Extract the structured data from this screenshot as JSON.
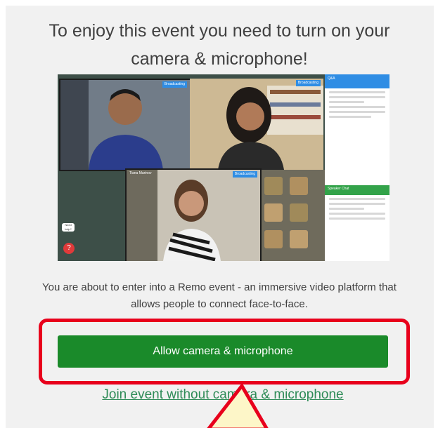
{
  "headline": "To enjoy this event you need to turn on your camera & microphone!",
  "preview": {
    "tag_1": "Broadcasting",
    "tag_2": "Broadcasting",
    "tag_3": "Broadcasting",
    "tile_3_name": "Tiana Marinov",
    "chat_title": "Q&A",
    "chat_section": "Speaker Chat",
    "help_label": "Need help?"
  },
  "description": "You are about to enter into a Remo event - an immersive video platform that allows people to connect face-to-face.",
  "allow_button": "Allow camera & microphone",
  "join_link": "Join event without camera & microphone",
  "colors": {
    "primary_button": "#1a8a2a",
    "link": "#2e8b57",
    "highlight": "#e8001c",
    "callout": "#fdf6c8"
  }
}
